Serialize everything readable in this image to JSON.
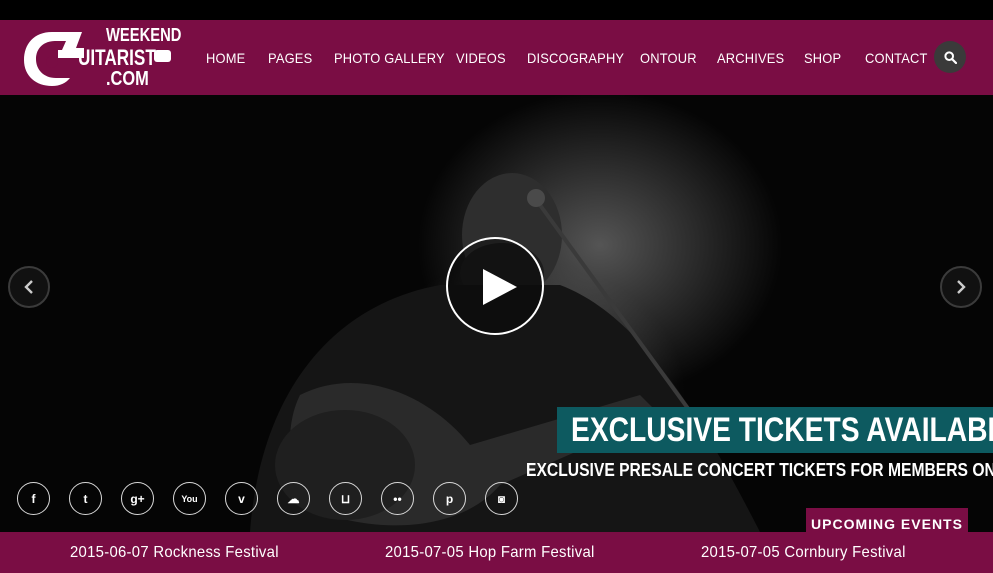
{
  "logo": {
    "line1": "WEEKEND",
    "line2": "UITARIST",
    "line3": ".COM"
  },
  "nav": {
    "items": [
      "HOME",
      "PAGES",
      "PHOTO GALLERY",
      "VIDEOS",
      "DISCOGRAPHY",
      "ONTOUR",
      "ARCHIVES",
      "SHOP",
      "CONTACT"
    ],
    "search_icon": "search-icon"
  },
  "hero": {
    "title": "EXCLUSIVE TICKETS AVAILABLE",
    "subtitle": "EXCLUSIVE PRESALE CONCERT TICKETS FOR MEMBERS ONLY",
    "play_icon": "play-icon",
    "prev_icon": "chevron-left-icon",
    "next_icon": "chevron-right-icon"
  },
  "social": [
    {
      "name": "facebook-icon",
      "glyph": "f"
    },
    {
      "name": "twitter-icon",
      "glyph": "t"
    },
    {
      "name": "google-plus-icon",
      "glyph": "g+"
    },
    {
      "name": "youtube-icon",
      "glyph": "You"
    },
    {
      "name": "vimeo-icon",
      "glyph": "v"
    },
    {
      "name": "soundcloud-icon",
      "glyph": "☁"
    },
    {
      "name": "lastfm-icon",
      "glyph": "⊔"
    },
    {
      "name": "flickr-icon",
      "glyph": "••"
    },
    {
      "name": "pinterest-icon",
      "glyph": "p"
    },
    {
      "name": "instagram-icon",
      "glyph": "◙"
    }
  ],
  "upcoming": {
    "label": "UPCOMING EVENTS"
  },
  "events": [
    "2015-06-07 Rockness Festival",
    "2015-07-05 Hop Farm Festival",
    "2015-07-05 Cornbury Festival"
  ],
  "colors": {
    "brand": "#7a0d44",
    "caption_bg": "#0d5a60",
    "hero_bg": "#050505"
  }
}
